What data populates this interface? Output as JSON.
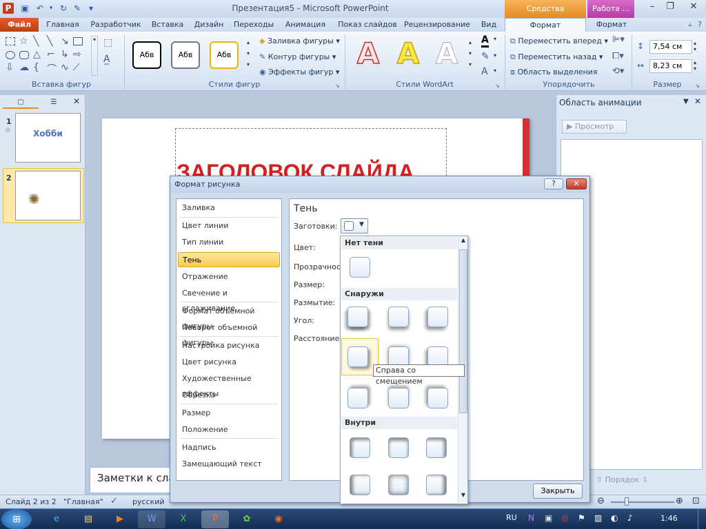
{
  "app": {
    "title": "Презентация5 - Microsoft PowerPoint",
    "contextual_drawing": "Средства рисования",
    "contextual_picture": "Работа ..."
  },
  "tabs": [
    "Файл",
    "Главная",
    "Разработчик",
    "Вставка",
    "Дизайн",
    "Переходы",
    "Анимация",
    "Показ слайдов",
    "Рецензирование",
    "Вид",
    "Формат",
    "Формат"
  ],
  "ribbon": {
    "groups": {
      "insert_shapes": "Вставка фигур",
      "shape_styles": "Стили фигур",
      "wordart_styles": "Стили WordArt",
      "arrange": "Упорядочить",
      "size": "Размер"
    },
    "style_sample": "Абв",
    "fill": "Заливка фигуры",
    "outline": "Контур фигуры",
    "effects": "Эффекты фигур",
    "bring_forward": "Переместить вперед",
    "send_backward": "Переместить назад",
    "selection_pane": "Область выделения",
    "height": "7,54 см",
    "width": "8,23 см",
    "wordart_letter": "A",
    "text_letter": "A"
  },
  "thumbs": [
    {
      "num": "1",
      "text": "Хобби"
    },
    {
      "num": "2",
      "text": ""
    }
  ],
  "slide": {
    "title": "ЗАГОЛОВОК СЛАЙДА"
  },
  "notes": {
    "placeholder": "Заметки к слайду"
  },
  "anim_pane": {
    "title": "Область анимации",
    "preview": "Просмотр",
    "order": "Порядок"
  },
  "status": {
    "slide": "Слайд 2 из 2",
    "theme": "\"Главная\"",
    "lang": "русский"
  },
  "taskbar": {
    "lang": "RU",
    "time": "1:46"
  },
  "dialog": {
    "title": "Формат рисунка",
    "categories": [
      "Заливка",
      "Цвет линии",
      "Тип линии",
      "Тень",
      "Отражение",
      "Свечение и сглаживание",
      "Формат объемной фигуры",
      "Поворот объемной фигуры",
      "Настройка рисунка",
      "Цвет рисунка",
      "Художественные эффекты",
      "Обрезка",
      "Размер",
      "Положение",
      "Надпись",
      "Замещающий текст"
    ],
    "selected_category": "Тень",
    "panel_title": "Тень",
    "labels": {
      "presets": "Заготовки:",
      "color": "Цвет:",
      "transparency": "Прозрачность",
      "size": "Размер:",
      "blur": "Размытие:",
      "angle": "Угол:",
      "distance": "Расстояние:"
    },
    "close": "Закрыть",
    "help": "?"
  },
  "gallery": {
    "no_shadow": "Нет тени",
    "outer": "Снаружи",
    "inner": "Внутри",
    "tooltip": "Справа со смещением"
  }
}
